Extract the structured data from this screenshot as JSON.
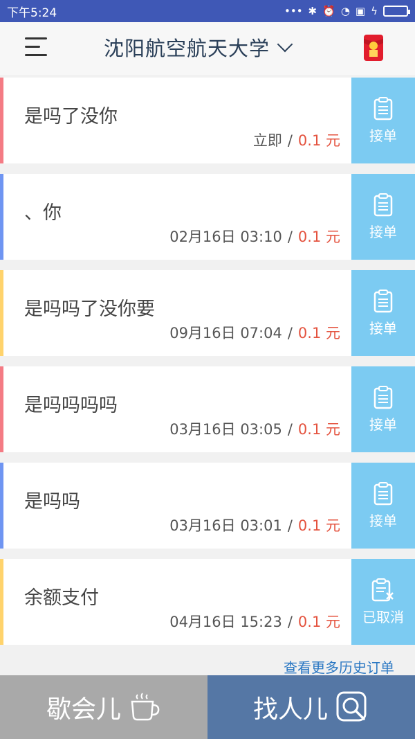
{
  "status_bar": {
    "time": "下午5:24",
    "icons": [
      "more-dots-icon",
      "bluetooth-icon",
      "alarm-icon",
      "wifi-icon",
      "sim-icon",
      "charging-icon",
      "battery-icon"
    ]
  },
  "header": {
    "title": "沈阳航空航天大学",
    "icons": [
      "menu-icon",
      "chevron-down-icon",
      "red-packet-icon"
    ]
  },
  "orders": [
    {
      "text": "是吗了没你",
      "time": "立即",
      "separator": "/",
      "price": "0.1 元",
      "action": "接单",
      "accent": "#f47b84"
    },
    {
      "text": "、你",
      "time": "02月16日 03:10",
      "separator": "/",
      "price": "0.1 元",
      "action": "接单",
      "accent": "#6f95f2"
    },
    {
      "text": "是吗吗了没你要",
      "time": "09月16日 07:04",
      "separator": "/",
      "price": "0.1 元",
      "action": "接单",
      "accent": "#ffd36c"
    },
    {
      "text": "是吗吗吗吗",
      "time": "03月16日 03:05",
      "separator": "/",
      "price": "0.1 元",
      "action": "接单",
      "accent": "#f47b84"
    },
    {
      "text": "是吗吗",
      "time": "03月16日 03:01",
      "separator": "/",
      "price": "0.1 元",
      "action": "接单",
      "accent": "#6f95f2"
    },
    {
      "text": "余额支付",
      "time": "04月16日 15:23",
      "separator": "/",
      "price": "0.1 元",
      "action": "已取消",
      "accent": "#ffd36c"
    }
  ],
  "history_link": "查看更多历史订单",
  "bottom_nav": {
    "left_label": "歇会儿",
    "right_label": "找人儿",
    "left_icon": "coffee-cup-icon",
    "right_icon": "search-icon"
  },
  "colors": {
    "status_bar": "#3f58b6",
    "action_button": "#7ccbf2",
    "price": "#e4533f",
    "nav_left": "#a9a9a9",
    "nav_right": "#5577a5"
  }
}
